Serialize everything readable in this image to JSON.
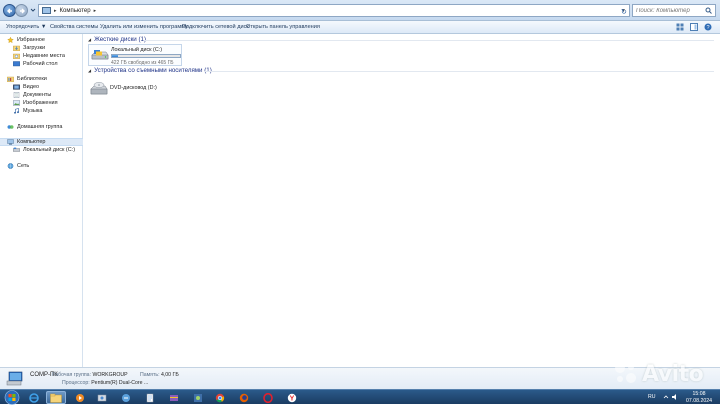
{
  "address": {
    "breadcrumb": "Компьютер",
    "search_placeholder": "Поиск: Компьютер"
  },
  "toolbar": {
    "organize": "Упорядочить ▼",
    "system_properties": "Свойства системы",
    "uninstall": "Удалить или изменить программу",
    "map_drive": "Подключить сетевой диск",
    "control_panel": "Открыть панель управления"
  },
  "sidebar": {
    "favorites": "Избранное",
    "downloads": "Загрузки",
    "recent": "Недавние места",
    "desktop": "Рабочий стол",
    "libraries": "Библиотеки",
    "video": "Видео",
    "documents": "Документы",
    "images": "Изображения",
    "music": "Музыка",
    "homegroup": "Домашняя группа",
    "computer": "Компьютер",
    "local_disk": "Локальный диск (C:)",
    "network": "Сеть"
  },
  "groups": {
    "hard_drives": "Жесткие диски (1)",
    "removable": "Устройства со съемными носителями (1)"
  },
  "drives": {
    "c_name": "Локальный диск (C:)",
    "c_free": "422 ГБ свободно из 465 ГБ",
    "c_used_fraction": 0.0925,
    "dvd_name": "DVD-дисковод (D:)"
  },
  "details": {
    "pc_name": "COMP-ПК",
    "workgroup_label": "Рабочая группа:",
    "workgroup_value": "WORKGROUP",
    "memory_label": "Память:",
    "memory_value": "4,00 ГБ",
    "processor_label": "Процессор:",
    "processor_value": "Pentium(R) Dual-Core ..."
  },
  "taskbar": {
    "lang": "RU",
    "time": "15:08",
    "date": "07.08.2024"
  },
  "watermark": "Avito",
  "colors": {
    "group_header": "#1e3287",
    "drive_fill": "#2a7ad1",
    "taskbar": "#1b3c62"
  }
}
